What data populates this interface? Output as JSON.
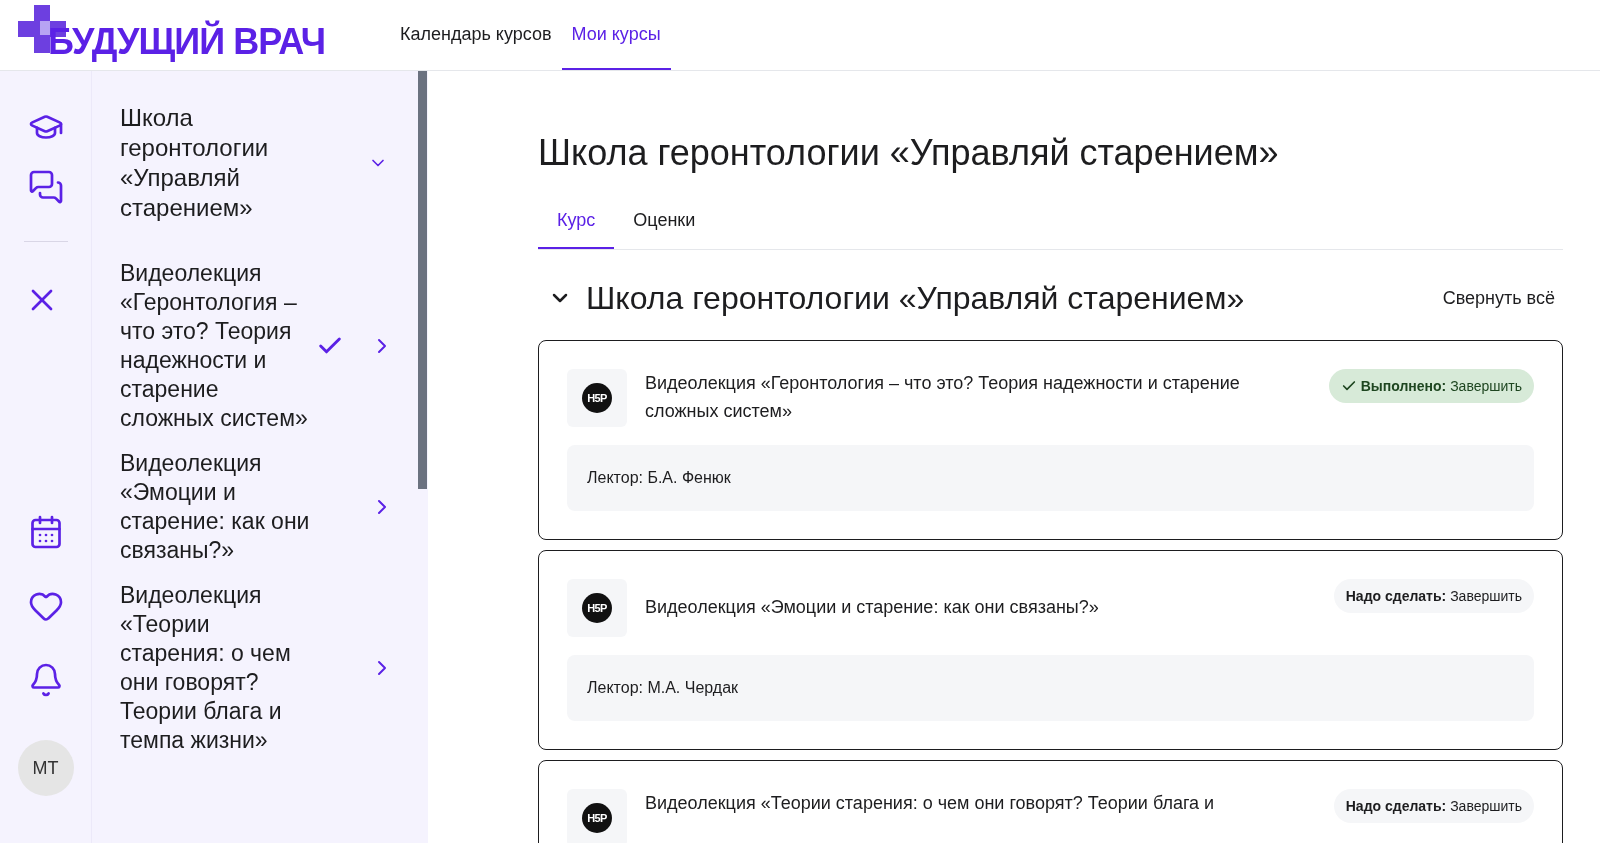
{
  "header": {
    "logo": "БУДУЩИЙ ВРАЧ",
    "nav": [
      {
        "label": "Календарь курсов",
        "selected": false
      },
      {
        "label": "Мои курсы",
        "selected": true
      }
    ]
  },
  "rail": {
    "icons": [
      {
        "kind": "school"
      },
      {
        "kind": "chat"
      },
      {
        "kind": "close"
      },
      {
        "kind": "calendar"
      },
      {
        "kind": "heart"
      },
      {
        "kind": "bell"
      }
    ],
    "avatar": "МТ"
  },
  "course_index": {
    "title": "Школа геронтологии «Управляй старением»",
    "expanded": true,
    "items": [
      {
        "label": "Видеолекция «Геронтология – что это? Теория надежности и старение сложных систем»",
        "completed": true
      },
      {
        "label": "Видеолекция «Эмоции и старение: как они связаны?»",
        "completed": false
      },
      {
        "label": "Видеолекция «Теории старения: о чем они говорят? Теории блага и темпа жизни»",
        "completed": false
      }
    ]
  },
  "page": {
    "title": "Школа геронтологии «Управляй старением»",
    "tabs": [
      {
        "label": "Курс",
        "selected": true
      },
      {
        "label": "Оценки",
        "selected": false
      }
    ],
    "section": {
      "title": "Школа геронтологии «Управляй старением»",
      "expanded": true,
      "collapse_all": "Свернуть всё"
    },
    "activities": [
      {
        "icon_text": "H5P",
        "title": "Видеолекция «Геронтология – что это? Теория надежности и старение сложных систем»",
        "completed": true,
        "badge": "**Выполнено:** Завершить",
        "description": "Лектор: Б.А. Фенюк"
      },
      {
        "icon_text": "H5P",
        "title": "Видеолекция «Эмоции и старение: как они связаны?»",
        "completed": false,
        "badge": "**Надо сделать:** Завершить",
        "description": "Лектор: М.А. Чердак"
      },
      {
        "icon_text": "H5P",
        "title": "Видеолекция «Теории старения: о чем они говорят? Теории блага и",
        "completed": false,
        "badge": "**Надо сделать:** Завершить"
      }
    ]
  }
}
